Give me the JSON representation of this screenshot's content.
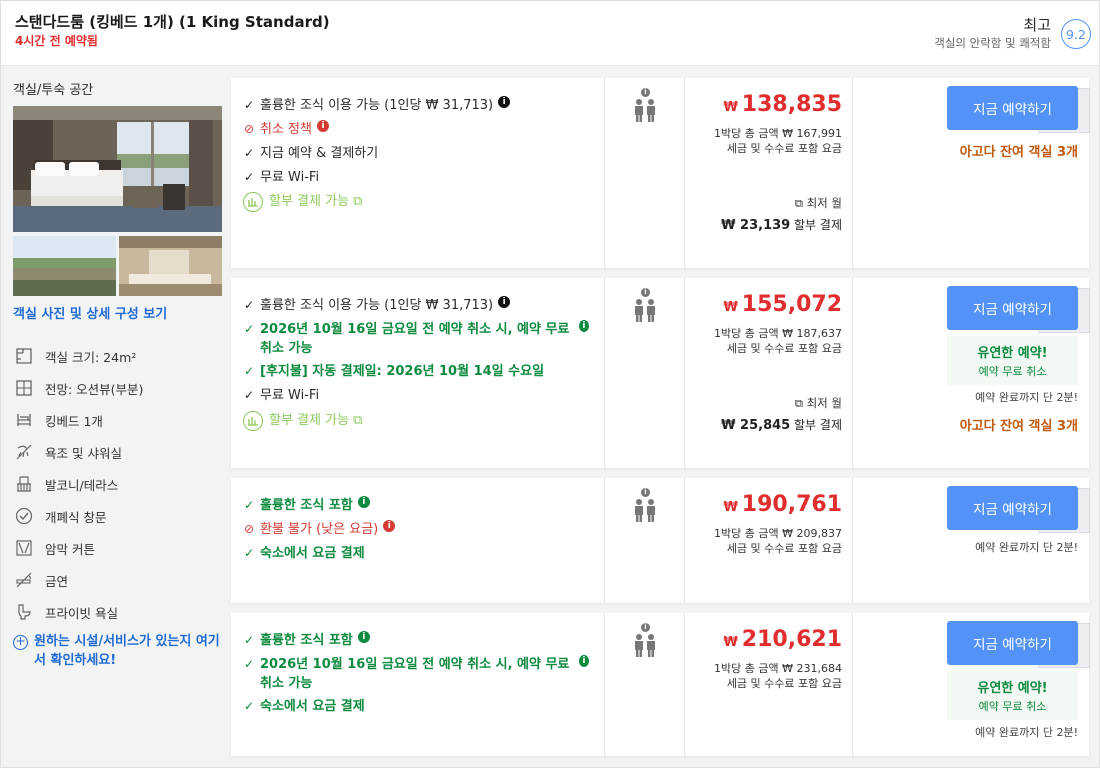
{
  "header": {
    "room_title": "스탠다드룸 (킹베드 1개) (1 King Standard)",
    "urgency": "4시간 전 예약됨",
    "rating_word": "최고",
    "rating_desc": "객실의 안락함 및 쾌적함",
    "score": "9.2"
  },
  "left": {
    "title": "객실/투숙 공간",
    "photo_link": "객실 사진 및 상세 구성 보기",
    "features": [
      {
        "label": "객실 크기: 24m²",
        "icon": "room-size-icon"
      },
      {
        "label": "전망: 오션뷰(부분)",
        "icon": "view-icon"
      },
      {
        "label": "킹베드 1개",
        "icon": "bed-icon"
      },
      {
        "label": "욕조 및 샤워실",
        "icon": "shower-icon"
      },
      {
        "label": "발코니/테라스",
        "icon": "balcony-icon"
      },
      {
        "label": "개폐식 창문",
        "icon": "window-icon"
      },
      {
        "label": "암막 커튼",
        "icon": "curtain-icon"
      },
      {
        "label": "금연",
        "icon": "no-smoking-icon"
      },
      {
        "label": "프라이빗 욕실",
        "icon": "toilet-icon"
      }
    ],
    "ask_text": "원하는 시설/서비스가 있는지 여기서 확인하세요!"
  },
  "offers": [
    {
      "lines": [
        {
          "style": "black",
          "mark": "✓",
          "text": "훌륭한 조식 이용 가능 (1인당 ₩ 31,713)",
          "info": "black"
        },
        {
          "style": "red",
          "mark": "⊘",
          "text": "취소 정책",
          "info": "red"
        },
        {
          "style": "black",
          "mark": "✓",
          "text": "지금 예약 & 결제하기",
          "info": ""
        },
        {
          "style": "black",
          "mark": "✓",
          "text": "무료 Wi-Fi",
          "info": ""
        },
        {
          "style": "lgreen",
          "mark": "inst",
          "text": "할부 결제 가능 ⧉",
          "info": ""
        }
      ],
      "currency": "₩",
      "price": "138,835",
      "total": "1박당 총 금액 ₩ 167,991",
      "tax": "세금 및 수수료 포함 요금",
      "min_month": "⧉ 최저 월",
      "inst_amount": "₩ 23,139",
      "inst_suffix": " 할부 결제",
      "qty": "1",
      "book": "지금 예약하기",
      "rooms_left": "아고다 잔여 객실 3개",
      "flex_title": "",
      "flex_sub": "",
      "quick": ""
    },
    {
      "lines": [
        {
          "style": "black",
          "mark": "✓",
          "text": "훌륭한 조식 이용 가능 (1인당 ₩ 31,713)",
          "info": "black"
        },
        {
          "style": "green",
          "mark": "✓",
          "text": "2026년 10월 16일 금요일 전 예약 취소 시, 예약 무료 취소 가능",
          "info": "green"
        },
        {
          "style": "green",
          "mark": "✓",
          "text": "[후지불] 자동 결제일: 2026년 10월 14일 수요일",
          "info": ""
        },
        {
          "style": "black",
          "mark": "✓",
          "text": "무료 Wi-Fi",
          "info": ""
        },
        {
          "style": "lgreen",
          "mark": "inst",
          "text": "할부 결제 가능 ⧉",
          "info": ""
        }
      ],
      "currency": "₩",
      "price": "155,072",
      "total": "1박당 총 금액 ₩ 187,637",
      "tax": "세금 및 수수료 포함 요금",
      "min_month": "⧉ 최저 월",
      "inst_amount": "₩ 25,845",
      "inst_suffix": " 할부 결제",
      "qty": "1",
      "book": "지금 예약하기",
      "rooms_left": "아고다 잔여 객실 3개",
      "flex_title": "유연한 예약!",
      "flex_sub": "예약 무료 취소",
      "quick": "예약 완료까지 단 2분!"
    },
    {
      "lines": [
        {
          "style": "green",
          "mark": "✓",
          "text": "훌륭한 조식 포함",
          "info": "green"
        },
        {
          "style": "red",
          "mark": "⊘",
          "text": "환불 불가 (낮은 요금)",
          "info": "red"
        },
        {
          "style": "green",
          "mark": "✓",
          "text": "숙소에서 요금 결제",
          "info": ""
        }
      ],
      "currency": "₩",
      "price": "190,761",
      "total": "1박당 총 금액 ₩ 209,837",
      "tax": "세금 및 수수료 포함 요금",
      "min_month": "",
      "inst_amount": "",
      "inst_suffix": "",
      "qty": "1",
      "book": "지금 예약하기",
      "rooms_left": "",
      "flex_title": "",
      "flex_sub": "",
      "quick": "예약 완료까지 단 2분!"
    },
    {
      "lines": [
        {
          "style": "green",
          "mark": "✓",
          "text": "훌륭한 조식 포함",
          "info": "green"
        },
        {
          "style": "green",
          "mark": "✓",
          "text": "2026년 10월 16일 금요일 전 예약 취소 시, 예약 무료 취소 가능",
          "info": "green"
        },
        {
          "style": "green",
          "mark": "✓",
          "text": "숙소에서 요금 결제",
          "info": ""
        }
      ],
      "currency": "₩",
      "price": "210,621",
      "total": "1박당 총 금액 ₩ 231,684",
      "tax": "세금 및 수수료 포함 요금",
      "min_month": "",
      "inst_amount": "",
      "inst_suffix": "",
      "qty": "1",
      "book": "지금 예약하기",
      "rooms_left": "",
      "flex_title": "유연한 예약!",
      "flex_sub": "예약 무료 취소",
      "quick": "예약 완료까지 단 2분!"
    }
  ],
  "colors": {
    "accent": "#5392f9",
    "price": "#e12d2d",
    "success": "#0c8a3e",
    "warning": "#c0590b"
  }
}
